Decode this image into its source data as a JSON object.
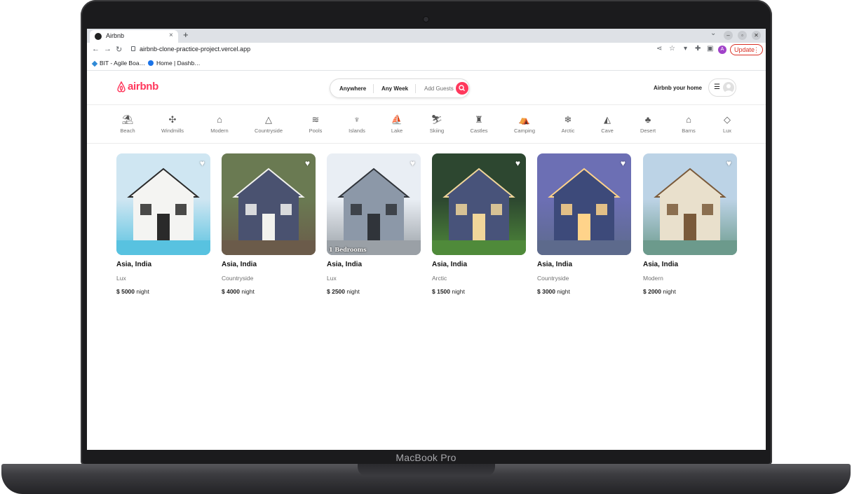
{
  "device": {
    "brand": "MacBook Pro"
  },
  "browser": {
    "tab": {
      "title": "Airbnb",
      "close": "×",
      "new_tab": "+"
    },
    "url": "airbnb-clone-practice-project.vercel.app",
    "update_label": "Update",
    "profile_initial": "A",
    "bookmarks": [
      {
        "label": "BIT - Agile Boa…"
      },
      {
        "label": "Home | Dashb…"
      }
    ]
  },
  "header": {
    "logo_text": "airbnb",
    "search": {
      "where": "Anywhere",
      "when": "Any Week",
      "who": "Add Guests"
    },
    "host_link": "Airbnb your home"
  },
  "categories": [
    {
      "label": "Beach",
      "icon": "beach-icon",
      "glyph": "⛱"
    },
    {
      "label": "Windmills",
      "icon": "windmill-icon",
      "glyph": "✣"
    },
    {
      "label": "Modern",
      "icon": "modern-house-icon",
      "glyph": "⌂"
    },
    {
      "label": "Countryside",
      "icon": "countryside-icon",
      "glyph": "△"
    },
    {
      "label": "Pools",
      "icon": "pool-icon",
      "glyph": "≋"
    },
    {
      "label": "Islands",
      "icon": "island-icon",
      "glyph": "♆"
    },
    {
      "label": "Lake",
      "icon": "lake-icon",
      "glyph": "⛵"
    },
    {
      "label": "Skiing",
      "icon": "skiing-icon",
      "glyph": "⛷"
    },
    {
      "label": "Castles",
      "icon": "castle-icon",
      "glyph": "♜"
    },
    {
      "label": "Camping",
      "icon": "camping-icon",
      "glyph": "⛺"
    },
    {
      "label": "Arctic",
      "icon": "snowflake-icon",
      "glyph": "❄"
    },
    {
      "label": "Cave",
      "icon": "cave-icon",
      "glyph": "◭"
    },
    {
      "label": "Desert",
      "icon": "cactus-icon",
      "glyph": "♣"
    },
    {
      "label": "Barns",
      "icon": "barn-icon",
      "glyph": "⌂"
    },
    {
      "label": "Lux",
      "icon": "diamond-icon",
      "glyph": "◇"
    }
  ],
  "listings": [
    {
      "location": "Asia, India",
      "category": "Lux",
      "price": "$ 5000",
      "unit": "night",
      "palette": {
        "sky": "#cfe6f2",
        "wall": "#f4f4f2",
        "accent": "#2a2a2a",
        "ground": "#58c2e0"
      }
    },
    {
      "location": "Asia, India",
      "category": "Countryside",
      "price": "$ 4000",
      "unit": "night",
      "palette": {
        "sky": "#6a7a52",
        "wall": "#4a5270",
        "accent": "#f2f2ee",
        "ground": "#6b5b4a"
      }
    },
    {
      "location": "Asia, India",
      "category": "Lux",
      "price": "$ 2500",
      "unit": "night",
      "palette": {
        "sky": "#e9eef4",
        "wall": "#8c98a8",
        "accent": "#30343a",
        "ground": "#9aa0a6"
      },
      "overlay_text": "1 Bedrooms"
    },
    {
      "location": "Asia, India",
      "category": "Arctic",
      "price": "$ 1500",
      "unit": "night",
      "palette": {
        "sky": "#2d4730",
        "wall": "#48537a",
        "accent": "#f1d69a",
        "ground": "#4f8a3a"
      }
    },
    {
      "location": "Asia, India",
      "category": "Countryside",
      "price": "$ 3000",
      "unit": "night",
      "palette": {
        "sky": "#6c6fb4",
        "wall": "#3d4a7a",
        "accent": "#ffd38a",
        "ground": "#5d6a8c"
      }
    },
    {
      "location": "Asia, India",
      "category": "Modern",
      "price": "$ 2000",
      "unit": "night",
      "palette": {
        "sky": "#bcd3e6",
        "wall": "#e9e0cc",
        "accent": "#7a5a3a",
        "ground": "#6c9a8c"
      }
    }
  ]
}
